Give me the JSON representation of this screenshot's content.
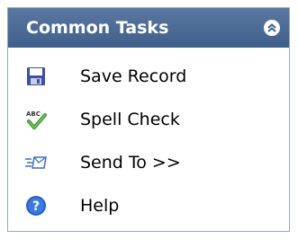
{
  "panel": {
    "title": "Common Tasks",
    "collapse_icon": "double-chevron-up-icon"
  },
  "tasks": [
    {
      "label": "Save Record",
      "icon": "floppy-disk-icon"
    },
    {
      "label": "Spell Check",
      "icon": "spell-check-icon"
    },
    {
      "label": "Send To >>",
      "icon": "send-to-icon"
    },
    {
      "label": "Help",
      "icon": "help-icon"
    }
  ],
  "colors": {
    "header_top": "#5a78a0",
    "header_bottom": "#3f5f8b",
    "border": "#9aa8ba"
  }
}
